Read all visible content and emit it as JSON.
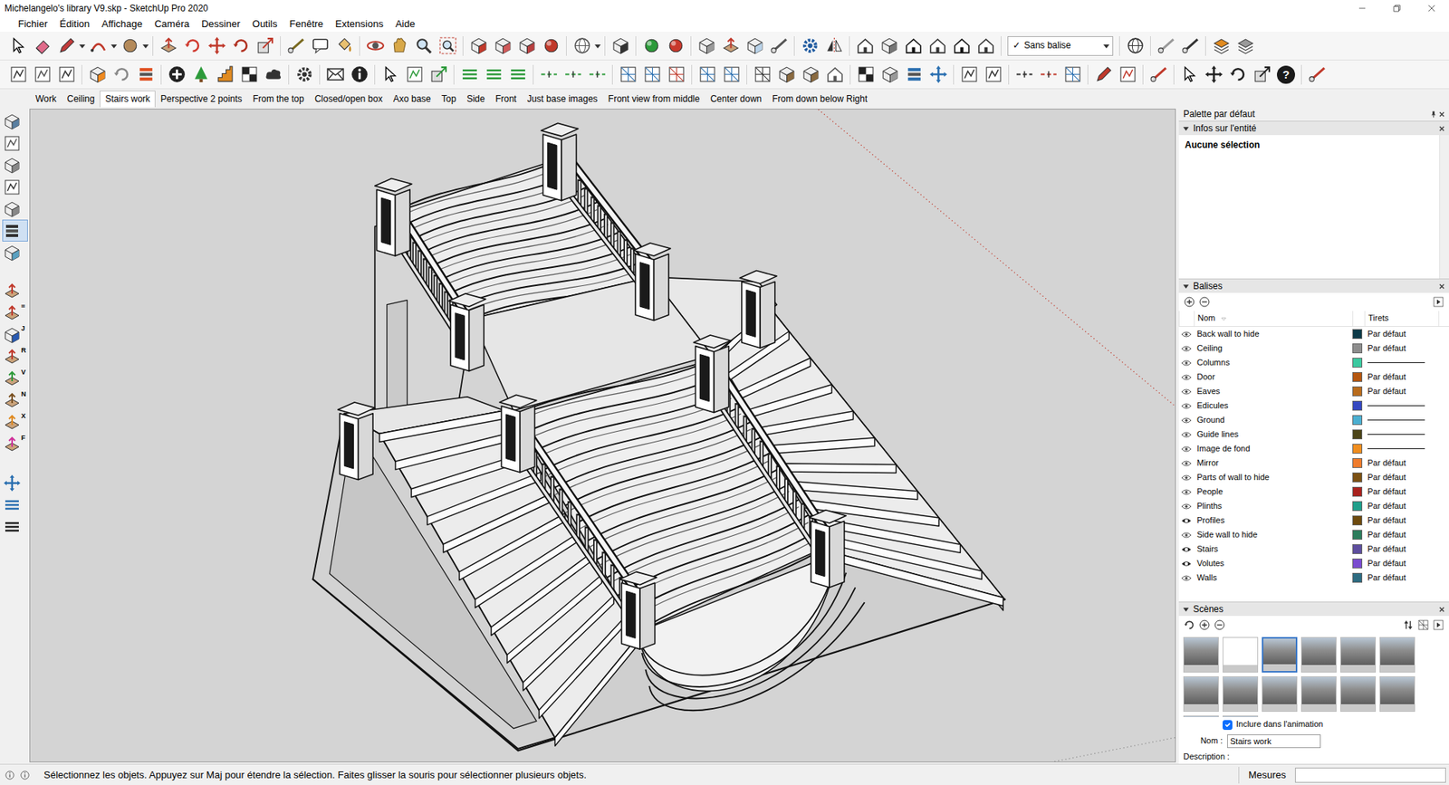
{
  "window": {
    "title": "Michelangelo's library V9.skp - SketchUp Pro 2020"
  },
  "menu": [
    "Fichier",
    "Édition",
    "Affichage",
    "Caméra",
    "Dessiner",
    "Outils",
    "Fenêtre",
    "Extensions",
    "Aide"
  ],
  "toolbar": {
    "tag_filter": {
      "check": "✓",
      "value": "Sans balise"
    },
    "help": "?"
  },
  "scene_tabs": [
    {
      "label": "Work",
      "selected": false
    },
    {
      "label": "Ceiling",
      "selected": false
    },
    {
      "label": "Stairs work",
      "selected": true
    },
    {
      "label": "Perspective 2 points",
      "selected": false
    },
    {
      "label": "From the top",
      "selected": false
    },
    {
      "label": "Closed/open box",
      "selected": false
    },
    {
      "label": "Axo base",
      "selected": false
    },
    {
      "label": "Top",
      "selected": false
    },
    {
      "label": "Side",
      "selected": false
    },
    {
      "label": "Front",
      "selected": false
    },
    {
      "label": "Just base images",
      "selected": false
    },
    {
      "label": "Front view from middle",
      "selected": false
    },
    {
      "label": "Center down",
      "selected": false
    },
    {
      "label": "From down below Right",
      "selected": false
    }
  ],
  "left_tools": [
    {
      "selected": false
    },
    {
      "selected": false
    },
    {
      "selected": false
    },
    {
      "selected": false
    },
    {
      "selected": false
    },
    {
      "selected": true
    },
    {
      "selected": false
    },
    {
      "selected": false
    },
    {
      "selected": false,
      "badge": "="
    },
    {
      "selected": false,
      "badge": "J"
    },
    {
      "selected": false,
      "badge": "R"
    },
    {
      "selected": false,
      "badge": "V"
    },
    {
      "selected": false,
      "badge": "N"
    },
    {
      "selected": false,
      "badge": "X"
    },
    {
      "selected": false,
      "badge": "F"
    },
    {
      "selected": false
    },
    {
      "selected": false
    },
    {
      "selected": false
    }
  ],
  "tray": {
    "title": "Palette par défaut"
  },
  "entity_info": {
    "title": "Infos sur l'entité",
    "content": "Aucune sélection"
  },
  "tags": {
    "title": "Balises",
    "columns": [
      "Nom",
      "Tirets"
    ],
    "rows": [
      {
        "name": "Back wall to hide",
        "visible": false,
        "color": "#0d3a48",
        "kind": "text",
        "dash": "Par défaut"
      },
      {
        "name": "Ceiling",
        "visible": false,
        "color": "#8c8c8c",
        "kind": "text",
        "dash": "Par défaut"
      },
      {
        "name": "Columns",
        "visible": false,
        "color": "#3bc9a0",
        "kind": "line"
      },
      {
        "name": "Door",
        "visible": false,
        "color": "#b4560f",
        "kind": "text",
        "dash": "Par défaut"
      },
      {
        "name": "Eaves",
        "visible": false,
        "color": "#b86b1c",
        "kind": "text",
        "dash": "Par défaut"
      },
      {
        "name": "Edicules",
        "visible": false,
        "color": "#3548c0",
        "kind": "line"
      },
      {
        "name": "Ground",
        "visible": false,
        "color": "#4aaed0",
        "kind": "line"
      },
      {
        "name": "Guide lines",
        "visible": false,
        "color": "#4b4418",
        "kind": "line"
      },
      {
        "name": "Image de fond",
        "visible": false,
        "color": "#ef8d1f",
        "kind": "line"
      },
      {
        "name": "Mirror",
        "visible": false,
        "color": "#ee7b2c",
        "kind": "text",
        "dash": "Par défaut"
      },
      {
        "name": "Parts of wall to hide",
        "visible": false,
        "color": "#7b5012",
        "kind": "text",
        "dash": "Par défaut"
      },
      {
        "name": "People",
        "visible": false,
        "color": "#a8221e",
        "kind": "text",
        "dash": "Par défaut"
      },
      {
        "name": "Plinths",
        "visible": false,
        "color": "#1f9e8a",
        "kind": "text",
        "dash": "Par défaut"
      },
      {
        "name": "Profiles",
        "visible": true,
        "color": "#6d4a0e",
        "kind": "text",
        "dash": "Par défaut"
      },
      {
        "name": "Side wall to hide",
        "visible": false,
        "color": "#2c7c5c",
        "kind": "text",
        "dash": "Par défaut"
      },
      {
        "name": "Stairs",
        "visible": true,
        "color": "#5e4e9e",
        "kind": "text",
        "dash": "Par défaut"
      },
      {
        "name": "Volutes",
        "visible": true,
        "color": "#7a4ccf",
        "kind": "text",
        "dash": "Par défaut"
      },
      {
        "name": "Walls",
        "visible": false,
        "color": "#2d6b80",
        "kind": "text",
        "dash": "Par défaut"
      }
    ]
  },
  "scenes": {
    "title": "Scènes",
    "thumbs": [
      {
        "kind": "image",
        "selected": false
      },
      {
        "kind": "blank",
        "selected": false
      },
      {
        "kind": "image",
        "selected": true
      },
      {
        "kind": "image",
        "selected": false
      },
      {
        "kind": "image",
        "selected": false
      },
      {
        "kind": "image",
        "selected": false
      },
      {
        "kind": "image",
        "selected": false
      },
      {
        "kind": "image",
        "selected": false
      },
      {
        "kind": "image",
        "selected": false
      },
      {
        "kind": "image",
        "selected": false
      },
      {
        "kind": "image",
        "selected": false
      },
      {
        "kind": "image",
        "selected": false
      },
      {
        "kind": "image",
        "selected": false
      },
      {
        "kind": "image",
        "selected": false
      }
    ],
    "include": {
      "label": "Inclure dans l'animation",
      "checked": true
    },
    "name": {
      "label": "Nom :",
      "value": "Stairs work"
    },
    "description": {
      "label": "Description :"
    }
  },
  "status": {
    "text": "Sélectionnez les objets. Appuyez sur Maj pour étendre la sélection. Faites glisser la souris pour sélectionner plusieurs objets.",
    "measures": "Mesures"
  }
}
